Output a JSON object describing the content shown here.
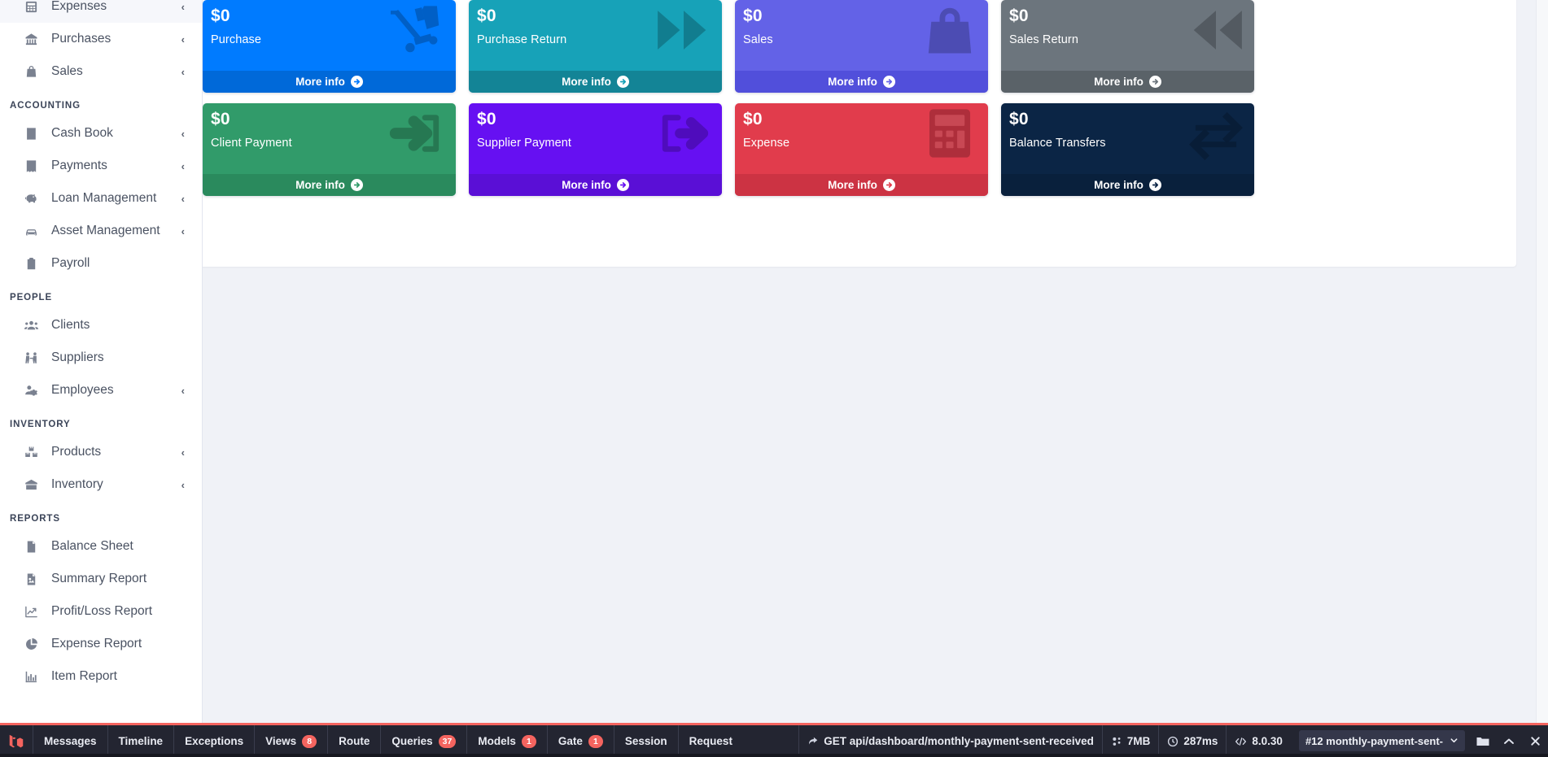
{
  "sidebar": {
    "groups": [
      {
        "title": null,
        "items": [
          {
            "label": "Expenses",
            "icon": "expenses-icon",
            "caret": "‹"
          },
          {
            "label": "Purchases",
            "icon": "purchases-icon",
            "caret": "‹"
          },
          {
            "label": "Sales",
            "icon": "sales-bag-icon",
            "caret": "‹"
          }
        ]
      },
      {
        "title": "ACCOUNTING",
        "items": [
          {
            "label": "Cash Book",
            "icon": "cash-book-icon",
            "caret": "‹"
          },
          {
            "label": "Payments",
            "icon": "payments-icon",
            "caret": "‹"
          },
          {
            "label": "Loan Management",
            "icon": "loan-icon",
            "caret": "‹"
          },
          {
            "label": "Asset Management",
            "icon": "asset-icon",
            "caret": "‹"
          },
          {
            "label": "Payroll",
            "icon": "payroll-icon",
            "caret": null
          }
        ]
      },
      {
        "title": "PEOPLE",
        "items": [
          {
            "label": "Clients",
            "icon": "clients-icon",
            "caret": null
          },
          {
            "label": "Suppliers",
            "icon": "suppliers-icon",
            "caret": null
          },
          {
            "label": "Employees",
            "icon": "employees-icon",
            "caret": "‹"
          }
        ]
      },
      {
        "title": "INVENTORY",
        "items": [
          {
            "label": "Products",
            "icon": "products-icon",
            "caret": "‹"
          },
          {
            "label": "Inventory",
            "icon": "inventory-icon",
            "caret": "‹"
          }
        ]
      },
      {
        "title": "REPORTS",
        "items": [
          {
            "label": "Balance Sheet",
            "icon": "balance-sheet-icon",
            "caret": null
          },
          {
            "label": "Summary Report",
            "icon": "summary-report-icon",
            "caret": null
          },
          {
            "label": "Profit/Loss Report",
            "icon": "profit-loss-icon",
            "caret": null
          },
          {
            "label": "Expense Report",
            "icon": "pie-chart-icon",
            "caret": null
          },
          {
            "label": "Item Report",
            "icon": "bar-chart-icon",
            "caret": null
          }
        ]
      }
    ]
  },
  "dashboard": {
    "more_info_label": "More info",
    "cards": [
      {
        "value": "$0",
        "label": "Purchase",
        "color": "#007bff",
        "footer_color": "#0069d9",
        "icon": "dolly-truck-icon"
      },
      {
        "value": "$0",
        "label": "Purchase Return",
        "color": "#17a2b8",
        "footer_color": "#138496",
        "icon": "forward-arrows-icon"
      },
      {
        "value": "$0",
        "label": "Sales",
        "color": "#6362e7",
        "footer_color": "#514fdb",
        "icon": "shopping-bag-icon"
      },
      {
        "value": "$0",
        "label": "Sales Return",
        "color": "#6c757d",
        "footer_color": "#5a6268",
        "icon": "backward-arrows-icon"
      },
      {
        "value": "$0",
        "label": "Client Payment",
        "color": "#319b6a",
        "footer_color": "#2a8a5d",
        "icon": "sign-in-arrow-icon"
      },
      {
        "value": "$0",
        "label": "Supplier Payment",
        "color": "#6610f2",
        "footer_color": "#5a0fd6",
        "icon": "sign-out-arrow-icon"
      },
      {
        "value": "$0",
        "label": "Expense",
        "color": "#e13c4c",
        "footer_color": "#cc3343",
        "icon": "calculator-icon"
      },
      {
        "value": "$0",
        "label": "Balance Transfers",
        "color": "#0b2545",
        "footer_color": "#09203c",
        "icon": "exchange-icon"
      }
    ]
  },
  "debugbar": {
    "logo": "laravel-logo-icon",
    "accent_color": "#f4645f",
    "tabs": [
      {
        "label": "Messages",
        "badge": null
      },
      {
        "label": "Timeline",
        "badge": null
      },
      {
        "label": "Exceptions",
        "badge": null
      },
      {
        "label": "Views",
        "badge": "8"
      },
      {
        "label": "Route",
        "badge": null
      },
      {
        "label": "Queries",
        "badge": "37"
      },
      {
        "label": "Models",
        "badge": "1"
      },
      {
        "label": "Gate",
        "badge": "1"
      },
      {
        "label": "Session",
        "badge": null
      },
      {
        "label": "Request",
        "badge": null
      }
    ],
    "request": {
      "method_path": "GET api/dashboard/monthly-payment-sent-received",
      "memory": "7MB",
      "time": "287ms",
      "php_version": "8.0.30"
    },
    "history_selected": "#12 monthly-payment-sent-",
    "controls": {
      "open_label": "folder-icon",
      "collapse_label": "chevron-up-icon",
      "close_label": "close-icon"
    }
  }
}
